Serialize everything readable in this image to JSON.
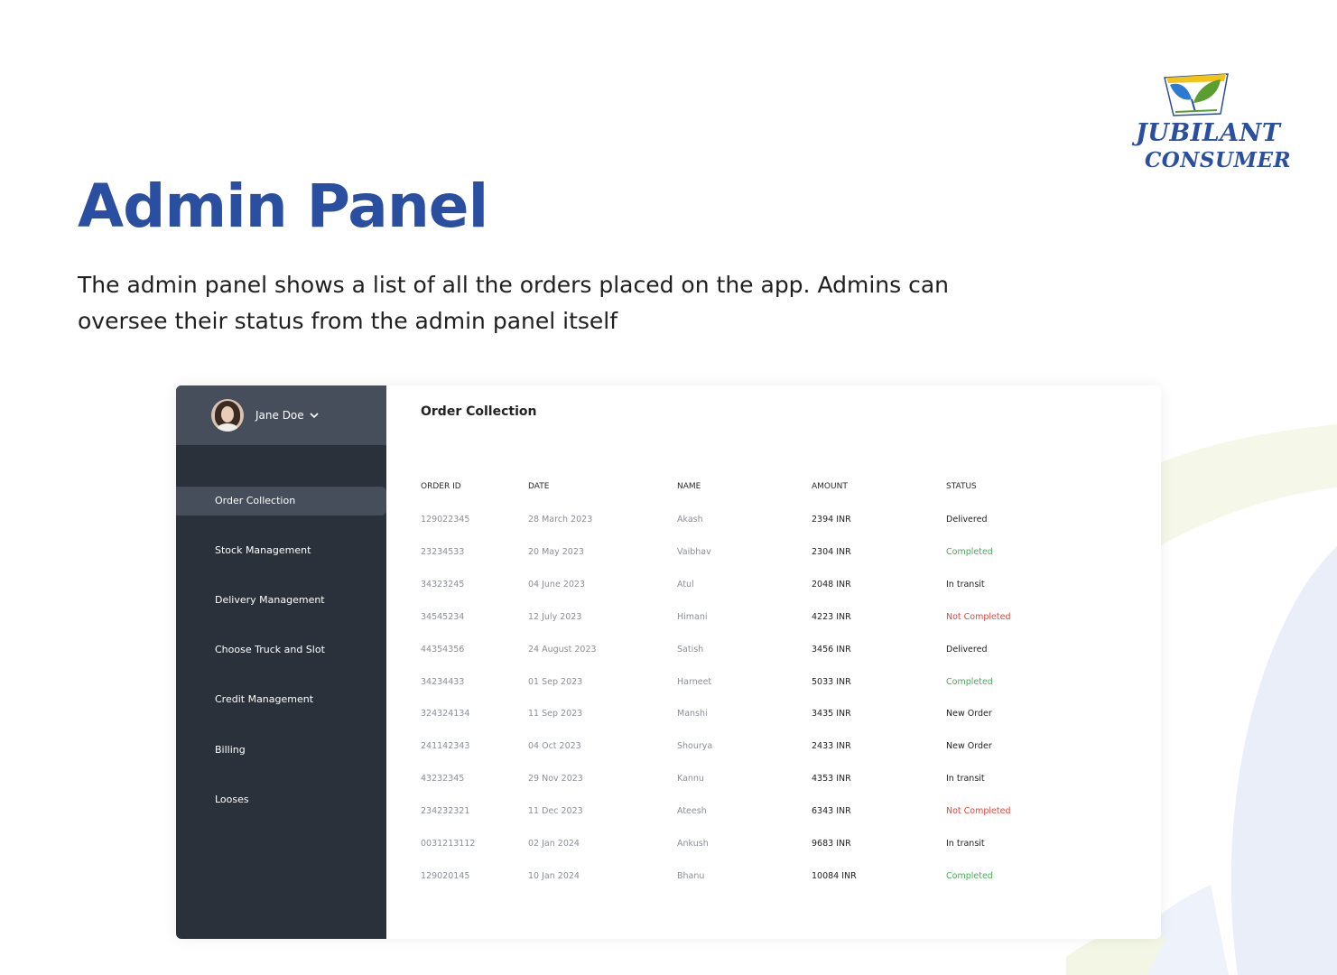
{
  "brand": {
    "line1": "JUBILANT",
    "line2": "CONSUMER",
    "colors": {
      "primary": "#2a4ea0",
      "logo_green": "#5a9e2f",
      "logo_yellow": "#f3c318"
    }
  },
  "hero": {
    "title": "Admin Panel",
    "description": "The admin panel shows a list of all the orders placed on the app. Admins can oversee their status from the admin panel itself"
  },
  "sidebar": {
    "profile": {
      "name": "Jane Doe",
      "icon": "chevron-down-icon"
    },
    "items": [
      {
        "label": "Order Collection",
        "active": true
      },
      {
        "label": "Stock Management",
        "active": false
      },
      {
        "label": "Delivery Management",
        "active": false
      },
      {
        "label": "Choose Truck and Slot",
        "active": false
      },
      {
        "label": "Credit Management",
        "active": false
      },
      {
        "label": "Billing",
        "active": false
      },
      {
        "label": "Looses",
        "active": false
      }
    ],
    "colors": {
      "background": "#2b313b",
      "highlight": "#454e5a"
    }
  },
  "main": {
    "title": "Order Collection",
    "table": {
      "headers": [
        "ORDER ID",
        "DATE",
        "NAME",
        "AMOUNT",
        "STATUS"
      ],
      "rows": [
        {
          "id": "129022345",
          "date": "28 March 2023",
          "name": "Akash",
          "amount": "2394 INR",
          "status": "Delivered"
        },
        {
          "id": "23234533",
          "date": "20 May 2023",
          "name": "Vaibhav",
          "amount": "2304 INR",
          "status": "Completed"
        },
        {
          "id": "34323245",
          "date": "04 June 2023",
          "name": "Atul",
          "amount": "2048 INR",
          "status": "In transit"
        },
        {
          "id": "34545234",
          "date": "12 July 2023",
          "name": "Himani",
          "amount": "4223 INR",
          "status": "Not Completed"
        },
        {
          "id": "44354356",
          "date": "24 August 2023",
          "name": "Satish",
          "amount": "3456 INR",
          "status": "Delivered"
        },
        {
          "id": "34234433",
          "date": "01 Sep 2023",
          "name": "Harneet",
          "amount": "5033 INR",
          "status": "Completed"
        },
        {
          "id": "324324134",
          "date": "11 Sep 2023",
          "name": "Manshi",
          "amount": "3435 INR",
          "status": "New Order"
        },
        {
          "id": "241142343",
          "date": "04 Oct 2023",
          "name": "Shourya",
          "amount": "2433 INR",
          "status": "New Order"
        },
        {
          "id": "43232345",
          "date": "29 Nov 2023",
          "name": "Kannu",
          "amount": "4353 INR",
          "status": "In transit"
        },
        {
          "id": "234232321",
          "date": "11 Dec 2023",
          "name": "Ateesh",
          "amount": "6343 INR",
          "status": "Not Completed"
        },
        {
          "id": "003121311​2",
          "date": "02 Jan 2024",
          "name": "Ankush",
          "amount": "9683 INR",
          "status": "In transit"
        },
        {
          "id": "129020145",
          "date": "10 Jan 2024",
          "name": "Bhanu",
          "amount": "10084 INR",
          "status": "Completed"
        }
      ],
      "status_colors": {
        "Completed": "#3fb34f",
        "Not Completed": "#e0453c",
        "default": "#1e1e1e"
      }
    }
  }
}
